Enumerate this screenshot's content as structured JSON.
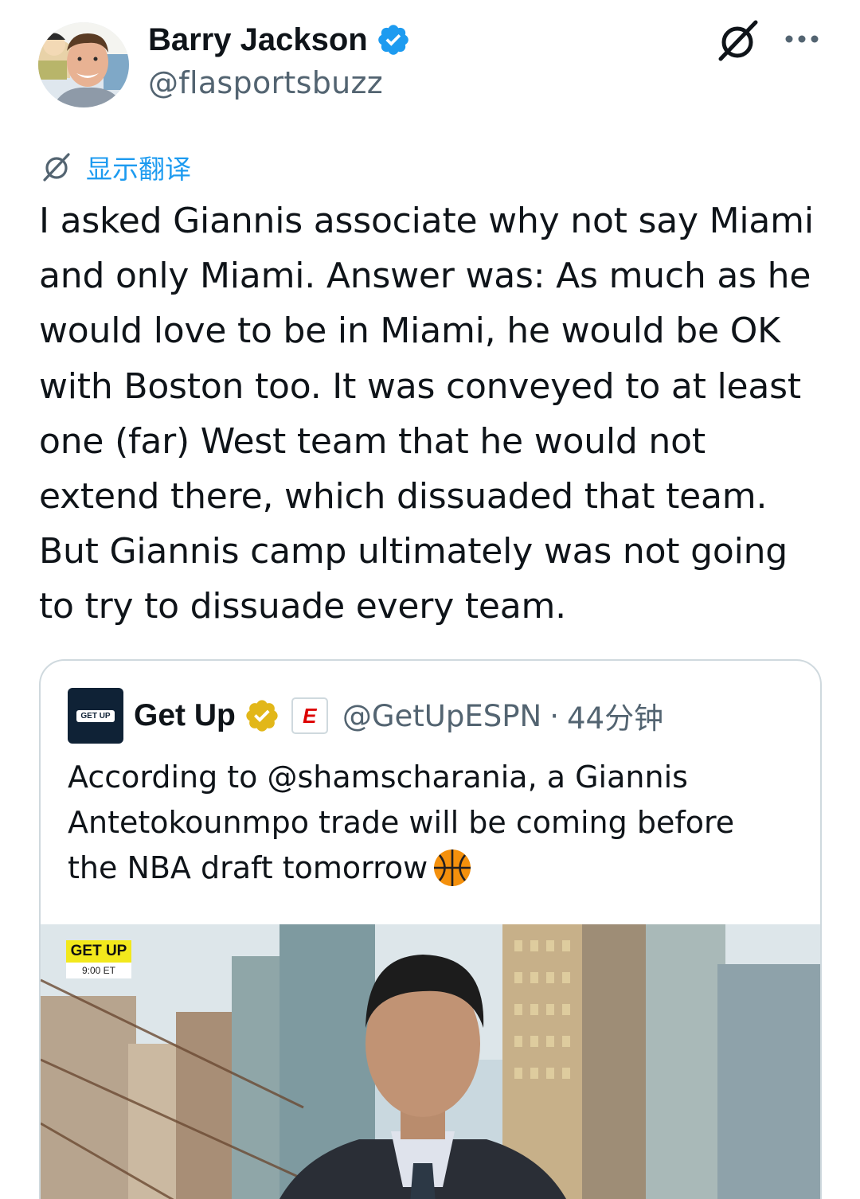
{
  "author": {
    "display_name": "Barry Jackson",
    "handle": "@flasportsbuzz"
  },
  "translate": {
    "label": "显示翻译"
  },
  "tweet": {
    "text": "I asked Giannis associate why not say Miami\nand only Miami. Answer was: As much as he\nwould love to be in Miami, he would be OK\nwith Boston too. It was conveyed to at least\none (far) West team that he would not\nextend there, which dissuaded that team.\nBut Giannis camp ultimately was not going\nto try to dissuade every team."
  },
  "quote": {
    "display_name": "Get Up",
    "affiliate_badge": "E",
    "handle": "@GetUpESPN",
    "separator": "·",
    "time": "44分钟",
    "text": "According to @shamscharania, a Giannis\nAntetokounmpo trade will be coming before\nthe NBA draft tomorrow",
    "avatar_label": "GET UP",
    "media": {
      "show_logo": "GET UP",
      "show_time": "9:00 ET"
    }
  },
  "icons": {
    "verified": "verified-badge-icon",
    "gold_verified": "gold-verified-badge-icon",
    "grok": "grok-icon",
    "more": "more-options-icon",
    "translate": "grok-translate-icon",
    "emoji": "basketball-emoji-icon"
  },
  "colors": {
    "link": "#1d9bf0",
    "secondary_text": "#536471",
    "border": "#cfd9de",
    "gold": "#e2b719"
  }
}
